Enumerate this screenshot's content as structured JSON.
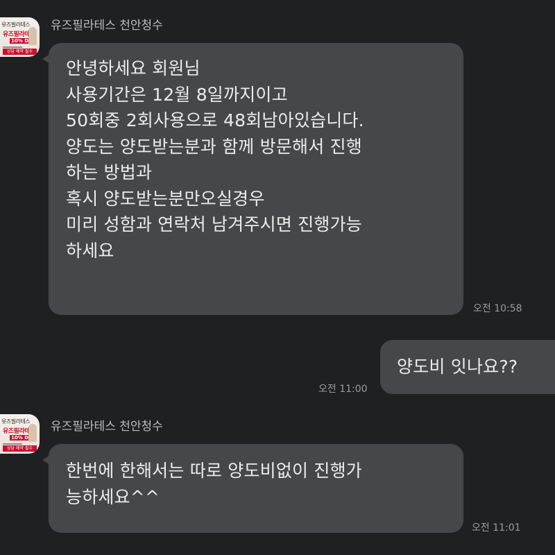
{
  "chat": {
    "messages": [
      {
        "sender": "유즈필라테스 천안청수",
        "direction": "incoming",
        "lines": [
          "안녕하세요 회원님",
          "사용기간은 12월 8일까지이고",
          "50회중 2회사용으로 48회남아있습니다.",
          "양도는 양도받는분과 함께 방문해서 진행",
          "하는 방법과",
          "혹시 양도받는분만오실경우",
          "미리 성함과 연락처 남겨주시면 진행가능",
          "하세요"
        ],
        "time": "오전 10:58"
      },
      {
        "direction": "outgoing",
        "lines": [
          "양도비 잇나요??"
        ],
        "time": "오전 11:00"
      },
      {
        "sender": "유즈필라테스 천안청수",
        "direction": "incoming",
        "lines": [
          "한번에 한해서는 따로 양도비없이 진행가",
          "능하세요^^"
        ],
        "time": "오전 11:01"
      }
    ],
    "avatar": {
      "top_text": "유즈필라테스",
      "brand_text": "유즈필라테스",
      "badge_text": "10% DC",
      "footer_text": "상담 예약 필수"
    },
    "colors": {
      "background": "#1f2022",
      "bubble": "#45474b",
      "text": "#ececec",
      "sender": "#bdbdbd",
      "time": "#9b9b9b"
    }
  }
}
